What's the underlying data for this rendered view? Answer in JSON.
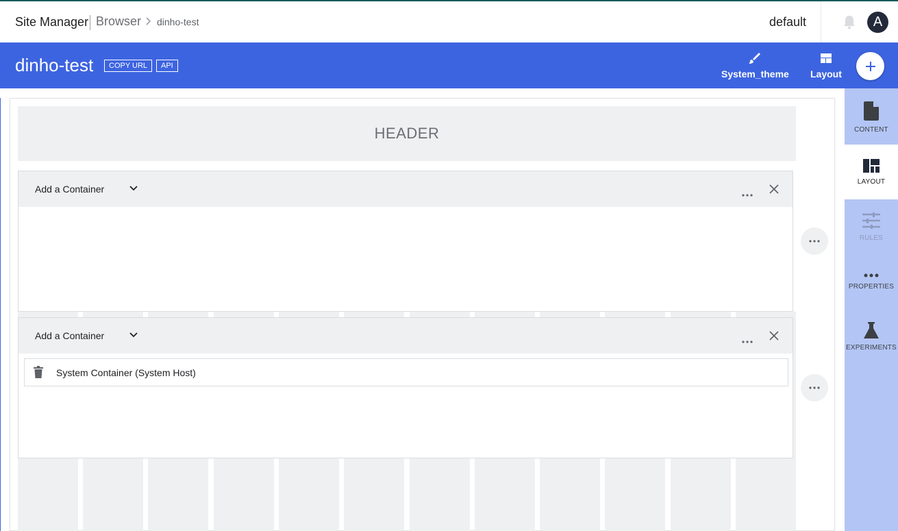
{
  "topbar": {
    "app_name": "Site Manager",
    "section": "Browser",
    "breadcrumb": "dinho-test",
    "site": "default",
    "avatar_letter": "A"
  },
  "page": {
    "title": "dinho-test",
    "copy_url_label": "COPY URL",
    "api_label": "API",
    "theme_label": "System_theme",
    "layout_label": "Layout",
    "accent_color": "#3d64e0"
  },
  "canvas": {
    "header_label": "HEADER",
    "containers": [
      {
        "label": "Add a Container",
        "items": []
      },
      {
        "label": "Add a Container",
        "items": [
          {
            "label": "System Container (System Host)"
          }
        ]
      }
    ]
  },
  "rightpanel": {
    "items": [
      {
        "label": "CONTENT",
        "icon": "file-icon"
      },
      {
        "label": "LAYOUT",
        "icon": "layout-icon"
      },
      {
        "label": "RULES",
        "icon": "tune-icon"
      },
      {
        "label": "PROPERTIES",
        "icon": "more-icon"
      },
      {
        "label": "EXPERIMENTS",
        "icon": "flask-icon"
      }
    ]
  }
}
